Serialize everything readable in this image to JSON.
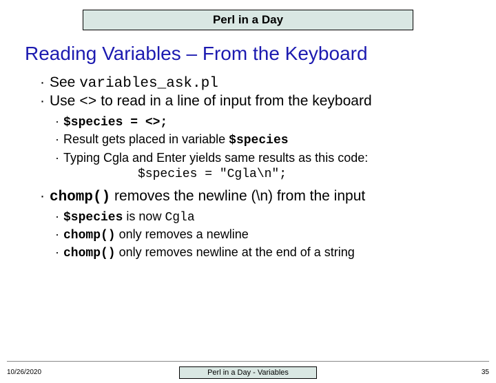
{
  "header": "Perl in a Day",
  "title": "Reading Variables – From the Keyboard",
  "bullets": {
    "b1_pre": "See ",
    "b1_code": "variables_ask.pl",
    "b2_pre": "Use ",
    "b2_code": "<>",
    "b2_post": " to read in a line of input from the keyboard",
    "b2_sub1": "$species = <>;",
    "b2_sub2_pre": "Result gets placed in variable ",
    "b2_sub2_code": "$species",
    "b2_sub3": "Typing Cgla and Enter yields same results as this code:",
    "b2_codeline": "$species = \"Cgla\\n\";",
    "b3_code": "chomp()",
    "b3_post": " removes the newline (\\n) from the input",
    "b3_sub1_code": "$species",
    "b3_sub1_mid": " is now ",
    "b3_sub1_code2": "Cgla",
    "b3_sub2_code": "chomp()",
    "b3_sub2_post": " only removes a newline",
    "b3_sub3_code": "chomp()",
    "b3_sub3_post": " only removes newline at the end of a string"
  },
  "footer": {
    "date": "10/26/2020",
    "center": "Perl in a Day - Variables",
    "page": "35"
  }
}
